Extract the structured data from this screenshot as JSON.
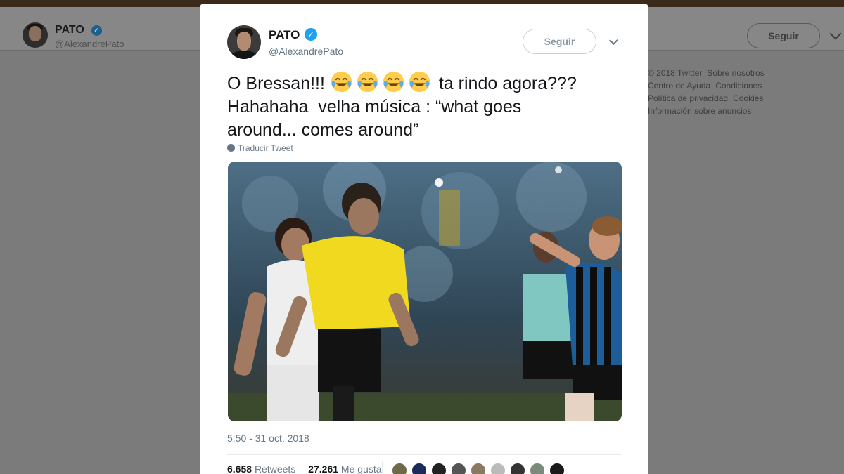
{
  "background": {
    "profile_name": "PATO",
    "profile_handle": "@AlexandrePato",
    "follow_label": "Seguir",
    "footer_links": [
      "© 2018 Twitter",
      "Sobre nosotros",
      "Centro de Ayuda",
      "Condiciones",
      "Política de privacidad",
      "Cookies",
      "Información sobre anuncios"
    ]
  },
  "tweet": {
    "author_name": "PATO",
    "author_handle": "@AlexandrePato",
    "follow_label": "Seguir",
    "text_line1_start": "O Bressan!!!",
    "text_line1_end": "ta rindo agora???",
    "text_line2": "Hahahaha  velha música : “what goes",
    "text_line3": "around... comes around”",
    "emoji_name": "face-with-tears-of-joy-icon",
    "translate_label": "Traducir Tweet",
    "timestamp": "5:50 - 31 oct. 2018",
    "retweets_count": "6.658",
    "retweets_label": "Retweets",
    "likes_count": "27.261",
    "likes_label": "Me gusta"
  },
  "colors": {
    "verified": "#1da1f2",
    "overlay": "#7b7b7b",
    "text_primary": "#14171a",
    "text_secondary": "#657786"
  }
}
